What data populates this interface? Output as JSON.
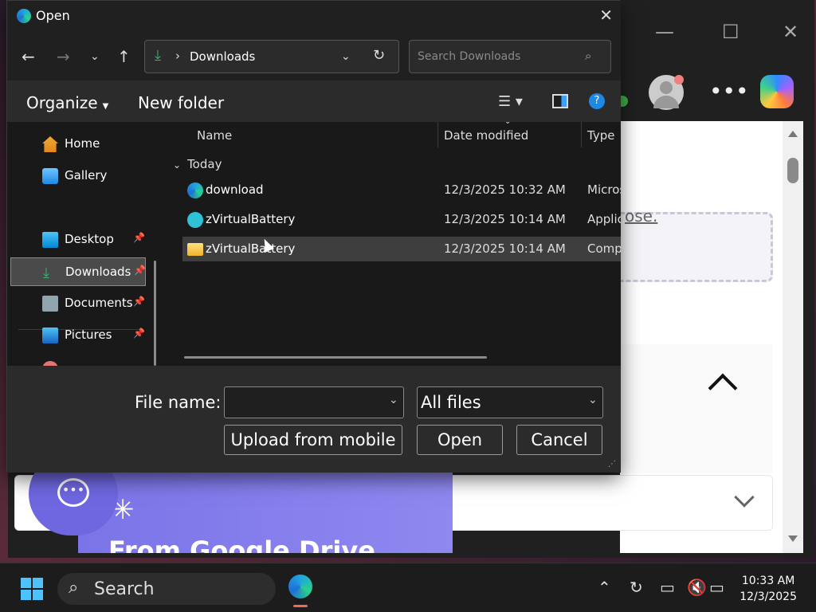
{
  "dialog": {
    "title": "Open",
    "address": "Downloads",
    "search_placeholder": "Search Downloads",
    "organize": "Organize",
    "new_folder": "New folder",
    "nav": [
      {
        "label": "Home",
        "pinned": false
      },
      {
        "label": "Gallery",
        "pinned": false
      },
      {
        "label": "Desktop",
        "pinned": true
      },
      {
        "label": "Downloads",
        "pinned": true,
        "selected": true
      },
      {
        "label": "Documents",
        "pinned": true
      },
      {
        "label": "Pictures",
        "pinned": true
      }
    ],
    "columns": {
      "name": "Name",
      "date": "Date modified",
      "type": "Type"
    },
    "group": "Today",
    "files": [
      {
        "name": "download",
        "date": "12/3/2025 10:32 AM",
        "type": "Micros",
        "icon": "edge-icon"
      },
      {
        "name": "zVirtualBattery",
        "date": "12/3/2025 10:14 AM",
        "type": "Applic",
        "icon": "app-icon"
      },
      {
        "name": "zVirtualBattery",
        "date": "12/3/2025 10:14 AM",
        "type": "Comp",
        "icon": "zip-folder-icon",
        "selected": true
      }
    ],
    "file_name_label": "File name:",
    "file_name_value": "",
    "filter": "All files",
    "buttons": {
      "upload": "Upload from mobile",
      "open": "Open",
      "cancel": "Cancel"
    }
  },
  "browser": {
    "upload_tail": "ose.",
    "card_title": "From Google Drive"
  },
  "taskbar": {
    "search": "Search",
    "time": "10:33 AM",
    "date": "12/3/2025"
  }
}
